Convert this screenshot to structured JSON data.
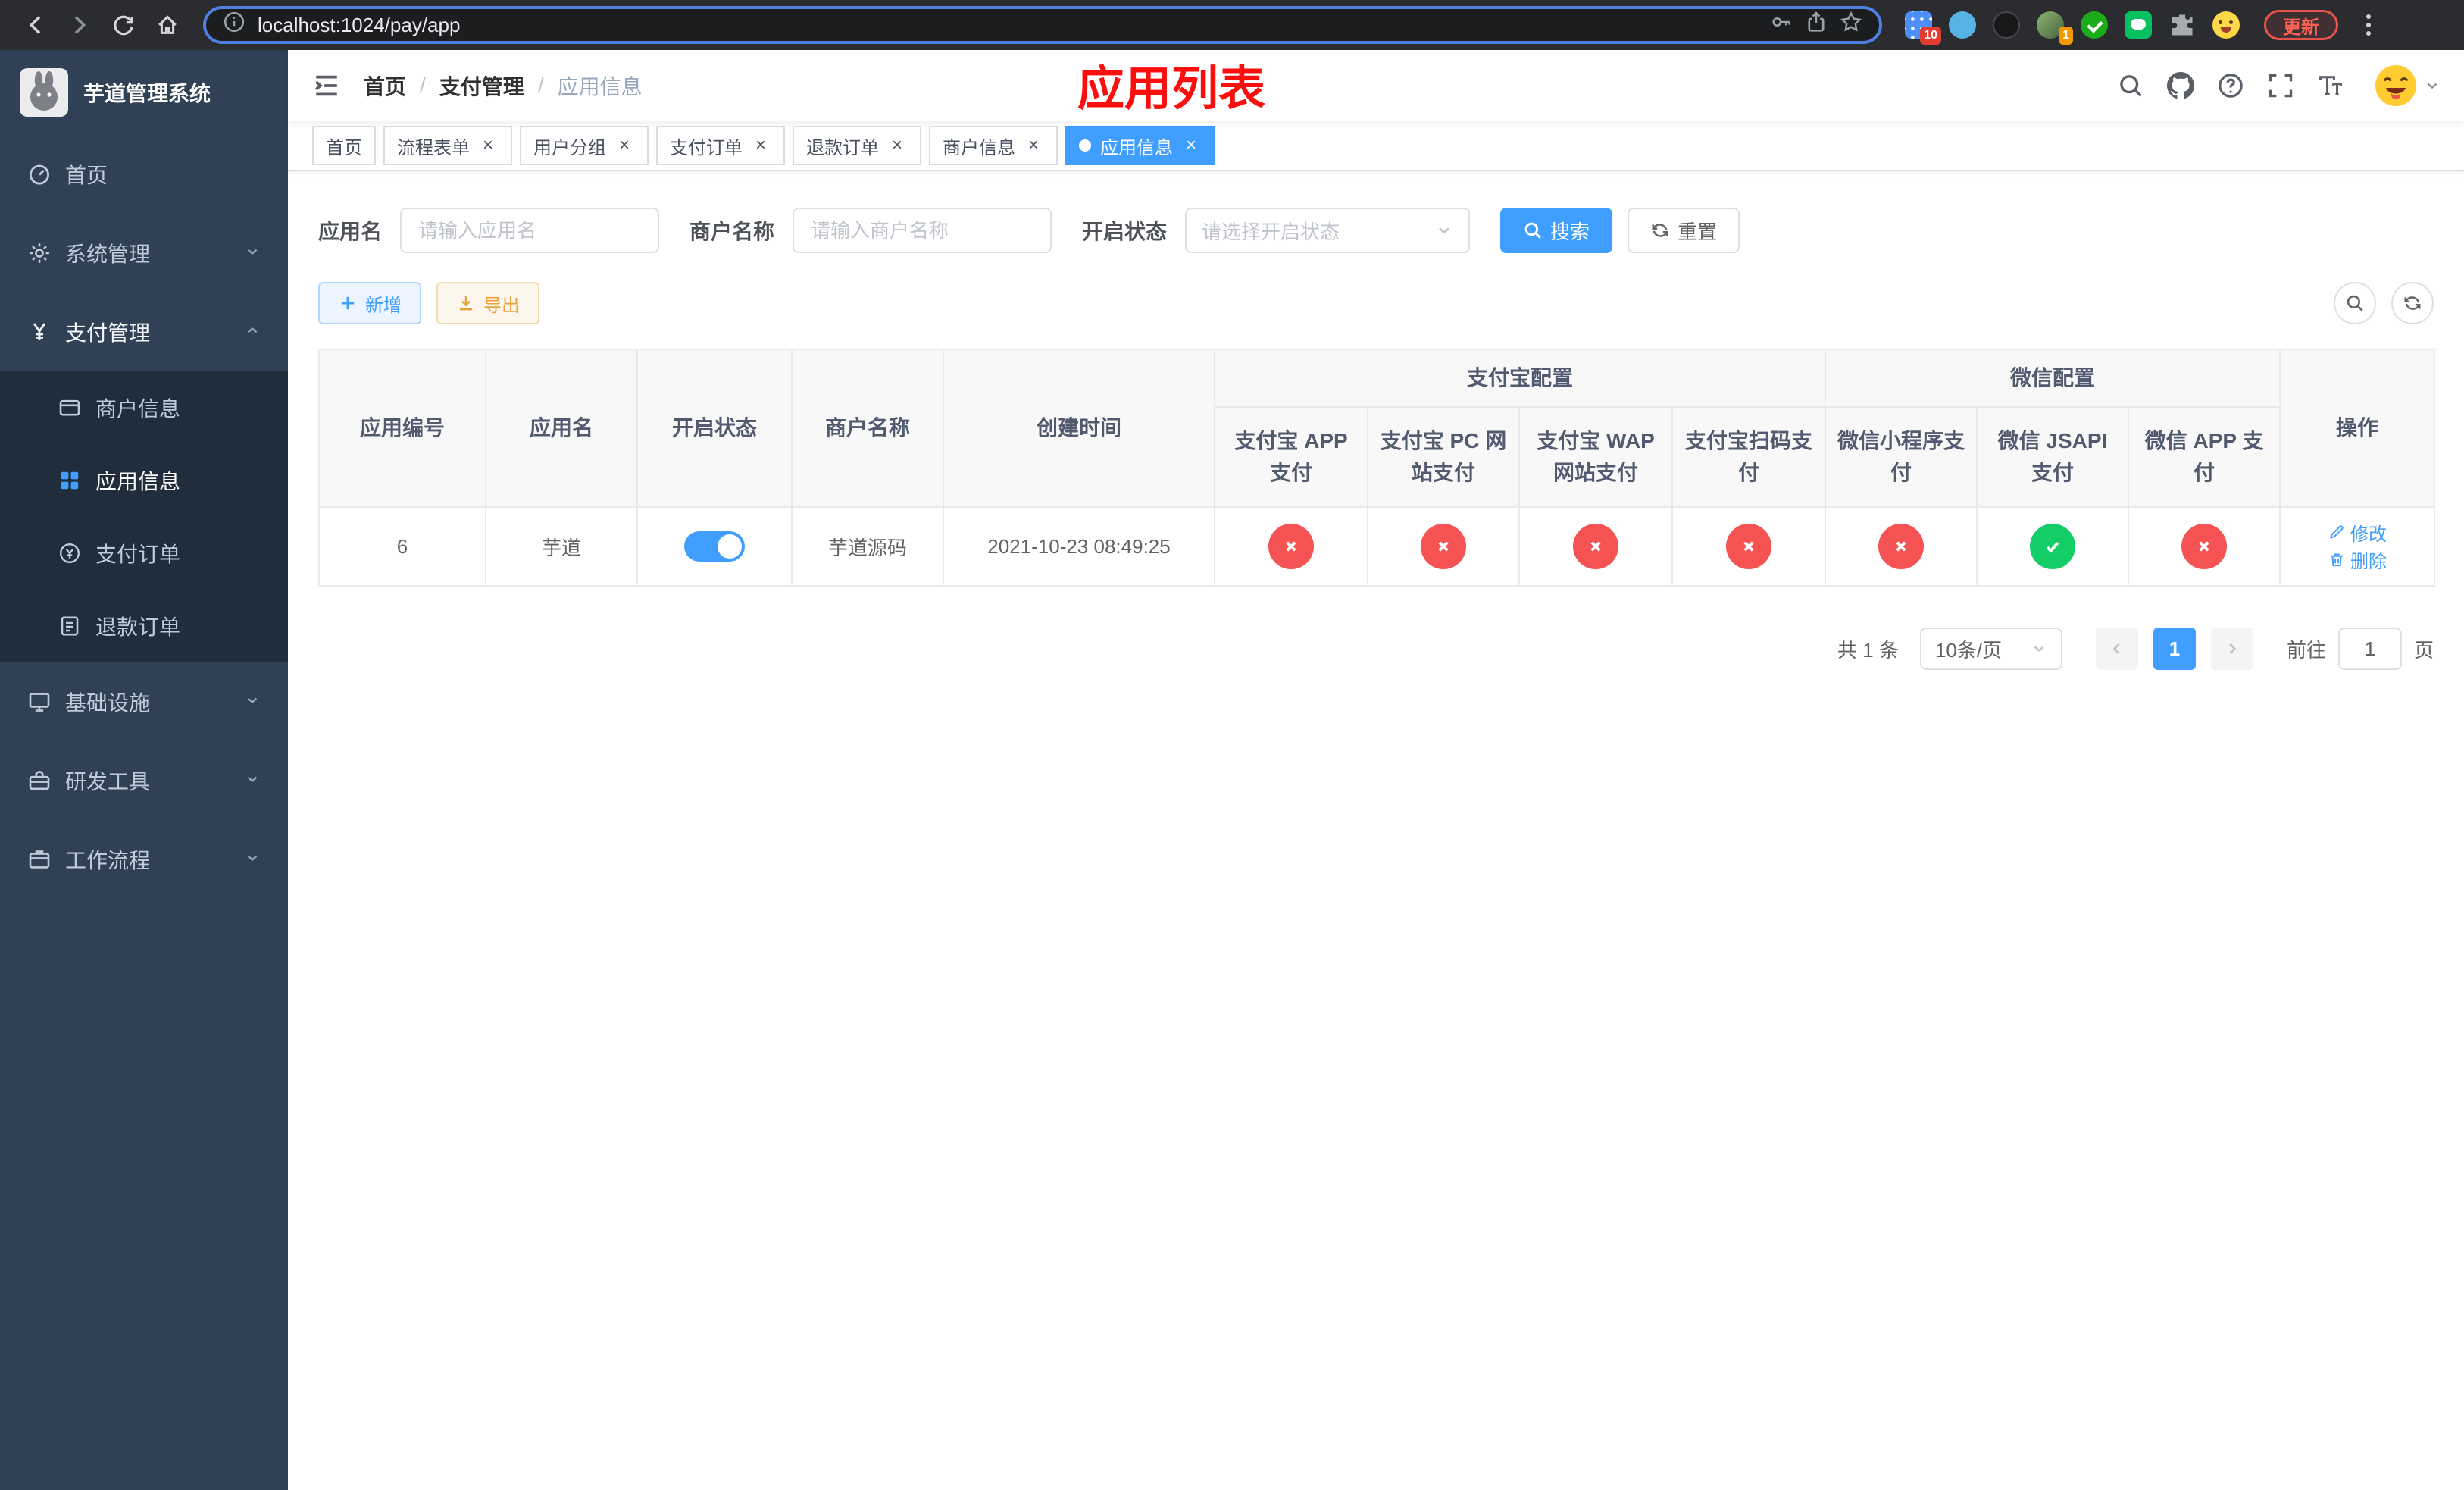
{
  "browser": {
    "url": "localhost:1024/pay/app",
    "update_label": "更新",
    "ext_badges": {
      "grid": "10",
      "avatar": "1"
    }
  },
  "sidebar": {
    "title": "芋道管理系统",
    "items": {
      "home": "首页",
      "system": "系统管理",
      "payment": "支付管理",
      "merchant": "商户信息",
      "app": "应用信息",
      "order": "支付订单",
      "refund": "退款订单",
      "infra": "基础设施",
      "devtools": "研发工具",
      "workflow": "工作流程"
    }
  },
  "header": {
    "breadcrumb": {
      "home": "首页",
      "section": "支付管理",
      "current": "应用信息"
    },
    "separator": "/",
    "annotation": "应用列表"
  },
  "tabs": [
    {
      "label": "首页"
    },
    {
      "label": "流程表单"
    },
    {
      "label": "用户分组"
    },
    {
      "label": "支付订单"
    },
    {
      "label": "退款订单"
    },
    {
      "label": "商户信息"
    },
    {
      "label": "应用信息"
    }
  ],
  "filters": {
    "app_name_label": "应用名",
    "app_name_placeholder": "请输入应用名",
    "merchant_label": "商户名称",
    "merchant_placeholder": "请输入商户名称",
    "status_label": "开启状态",
    "status_placeholder": "请选择开启状态",
    "search_label": "搜索",
    "reset_label": "重置"
  },
  "toolbar": {
    "add_label": "新增",
    "export_label": "导出"
  },
  "table": {
    "groups": {
      "alipay": "支付宝配置",
      "wechat": "微信配置"
    },
    "columns": {
      "id": "应用编号",
      "name": "应用名",
      "status": "开启状态",
      "merchant": "商户名称",
      "created": "创建时间",
      "alipay_app": "支付宝 APP 支付",
      "alipay_pc": "支付宝 PC 网站支付",
      "alipay_wap": "支付宝 WAP 网站支付",
      "alipay_qr": "支付宝扫码支付",
      "wx_mini": "微信小程序支付",
      "wx_jsapi": "微信 JSAPI 支付",
      "wx_app": "微信 APP 支付",
      "op": "操作"
    },
    "row": {
      "id": "6",
      "name": "芋道",
      "switch_on": true,
      "merchant": "芋道源码",
      "created": "2021-10-23 08:49:25",
      "statuses": [
        "fail",
        "fail",
        "fail",
        "fail",
        "fail",
        "success",
        "fail"
      ],
      "edit_label": "修改",
      "delete_label": "删除"
    }
  },
  "pagination": {
    "total": "共 1 条",
    "page_size": "10条/页",
    "current_page": "1",
    "goto_label": "前往",
    "goto_value": "1",
    "unit_label": "页"
  }
}
